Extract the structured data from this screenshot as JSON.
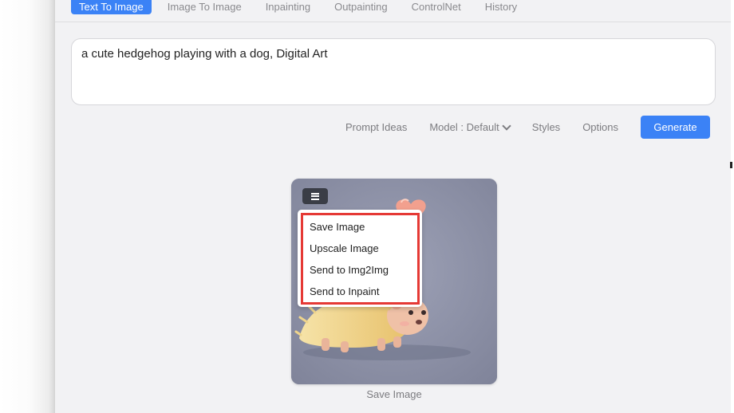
{
  "tabs": [
    {
      "label": "Text To Image",
      "active": true
    },
    {
      "label": "Image To Image"
    },
    {
      "label": "Inpainting"
    },
    {
      "label": "Outpainting"
    },
    {
      "label": "ControlNet"
    },
    {
      "label": "History"
    }
  ],
  "prompt": {
    "value": "a cute hedgehog playing with a dog, Digital Art"
  },
  "toolbar": {
    "prompt_ideas": "Prompt Ideas",
    "model": "Model : Default",
    "styles": "Styles",
    "options": "Options",
    "generate": "Generate"
  },
  "image_card": {
    "menu_items": [
      "Save Image",
      "Upscale Image",
      "Send to Img2Img",
      "Send to Inpaint"
    ],
    "caption": "Save Image"
  },
  "colors": {
    "accent": "#3b82f6",
    "highlight_border": "#e53935",
    "image_background": "#8e92a8"
  },
  "icons": {
    "menu": "hamburger-menu-icon",
    "model_dropdown": "chevron-down-icon"
  }
}
